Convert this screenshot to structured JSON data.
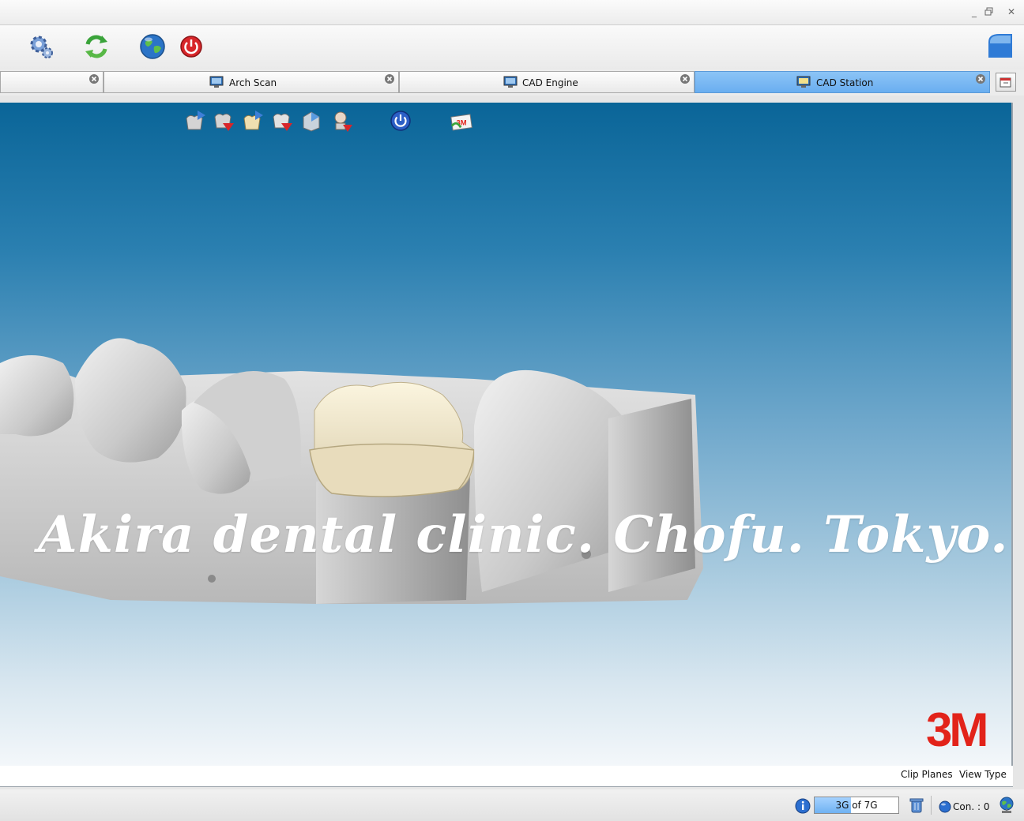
{
  "window": {
    "controls": [
      "minimize",
      "restore",
      "close"
    ]
  },
  "toolbar": {
    "items": [
      {
        "icon": "gear-icon"
      },
      {
        "icon": "refresh-icon"
      },
      {
        "icon": "globe-icon"
      },
      {
        "icon": "power-icon"
      }
    ],
    "app_badge_color": "#2f7bd6"
  },
  "tabs": [
    {
      "label": "",
      "active": false
    },
    {
      "label": "Arch Scan",
      "active": false
    },
    {
      "label": "CAD Engine",
      "active": false
    },
    {
      "label": "CAD Station",
      "active": true
    }
  ],
  "viewport": {
    "tools": [
      "import-scan-icon",
      "export-scan-icon",
      "import-crown-icon",
      "export-crown-icon",
      "die-icon",
      "patient-export-icon",
      "power-icon",
      "3m-export-icon"
    ],
    "watermark": "Akira dental clinic. Chofu. Tokyo.",
    "brand": "3M",
    "brand_color": "#e2231a",
    "background_top": "#0a6598",
    "background_bottom": "#f3f7fa"
  },
  "view_menu": {
    "clip_planes": "Clip Planes",
    "view_type": "View Type"
  },
  "status": {
    "memory_text": "3G of 7G",
    "memory_fraction": 0.43,
    "connections": "Con. : 0"
  }
}
